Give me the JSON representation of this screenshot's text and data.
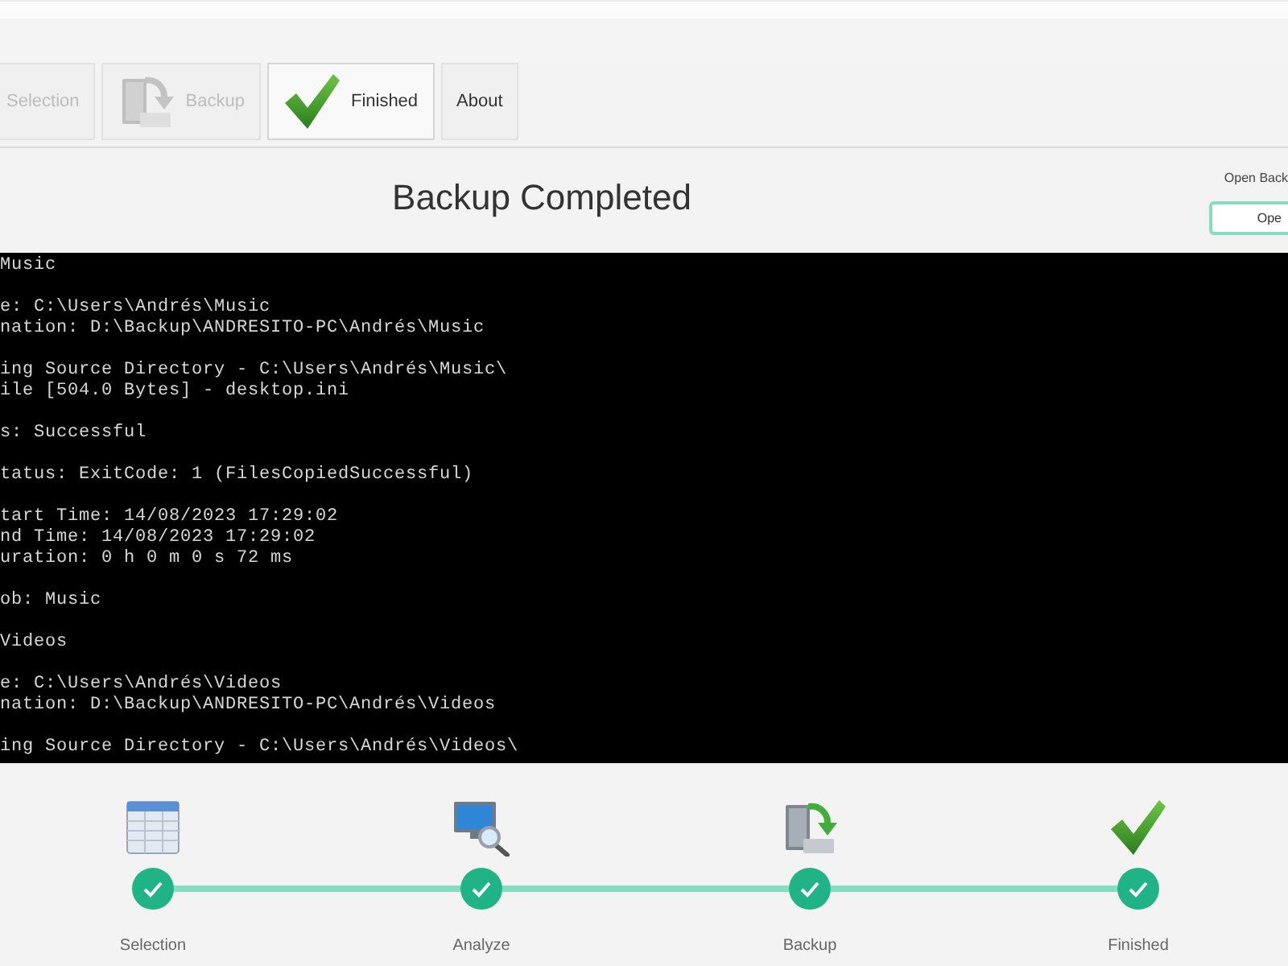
{
  "tabs": [
    {
      "label": "Selection",
      "selected": false,
      "disabled": true
    },
    {
      "label": "Backup",
      "selected": false,
      "disabled": true
    },
    {
      "label": "Finished",
      "selected": true,
      "disabled": false
    },
    {
      "label": "About",
      "selected": false,
      "disabled": false
    }
  ],
  "heading": "Backup Completed",
  "open_backup": {
    "label": "Open Back",
    "button": "Ope"
  },
  "console": {
    "blocks": [
      [
        "Music"
      ],
      [
        "e: C:\\Users\\Andrés\\Music",
        "nation: D:\\Backup\\ANDRESITO-PC\\Andrés\\Music"
      ],
      [
        "ing Source Directory - C:\\Users\\Andrés\\Music\\",
        "ile [504.0 Bytes] - desktop.ini"
      ],
      [
        "s: Successful"
      ],
      [
        "tatus: ExitCode: 1 (FilesCopiedSuccessful)"
      ],
      [
        "tart Time: 14/08/2023 17:29:02",
        "nd Time: 14/08/2023 17:29:02",
        "uration: 0 h 0 m 0 s 72 ms"
      ],
      [
        "ob: Music"
      ],
      [
        "Videos"
      ],
      [
        "e: C:\\Users\\Andrés\\Videos",
        "nation: D:\\Backup\\ANDRESITO-PC\\Andrés\\Videos"
      ],
      [
        "ing Source Directory - C:\\Users\\Andrés\\Videos\\"
      ]
    ]
  },
  "steps": [
    {
      "label": "Selection",
      "completed": true
    },
    {
      "label": "Analyze",
      "completed": true
    },
    {
      "label": "Backup",
      "completed": true
    },
    {
      "label": "Finished",
      "completed": true
    }
  ]
}
